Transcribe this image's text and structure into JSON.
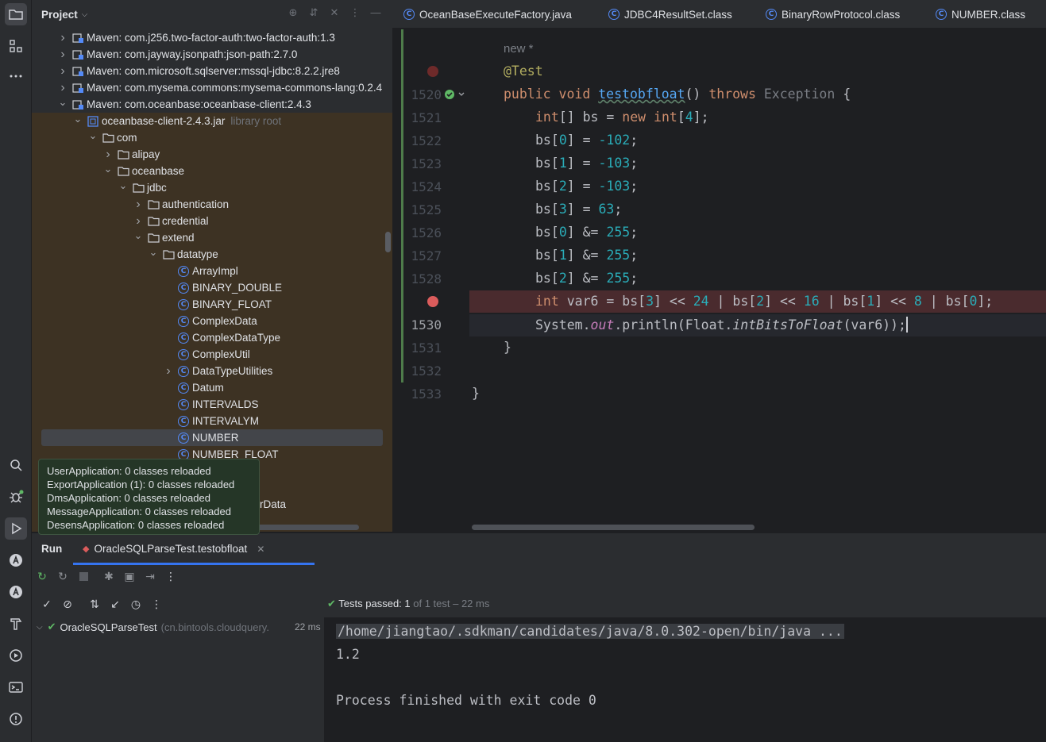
{
  "project": {
    "title": "Project",
    "tree": [
      {
        "label": "Maven: com.j256.two-factor-auth:two-factor-auth:1.3",
        "hint": "",
        "type": "lib",
        "indent": 0,
        "arrow": "right"
      },
      {
        "label": "Maven: com.jayway.jsonpath:json-path:2.7.0",
        "hint": "",
        "type": "lib",
        "indent": 0,
        "arrow": "right"
      },
      {
        "label": "Maven: com.microsoft.sqlserver:mssql-jdbc:8.2.2.jre8",
        "hint": "",
        "type": "lib",
        "indent": 0,
        "arrow": "right"
      },
      {
        "label": "Maven: com.mysema.commons:mysema-commons-lang:0.2.4",
        "hint": "",
        "type": "lib",
        "indent": 0,
        "arrow": "right"
      },
      {
        "label": "Maven: com.oceanbase:oceanbase-client:2.4.3",
        "hint": "",
        "type": "lib",
        "indent": 0,
        "arrow": "down"
      },
      {
        "label": "oceanbase-client-2.4.3.jar",
        "hint": "library root",
        "type": "jar",
        "indent": 1,
        "arrow": "down"
      },
      {
        "label": "com",
        "hint": "",
        "type": "folder",
        "indent": 2,
        "arrow": "down"
      },
      {
        "label": "alipay",
        "hint": "",
        "type": "folder",
        "indent": 3,
        "arrow": "right"
      },
      {
        "label": "oceanbase",
        "hint": "",
        "type": "folder",
        "indent": 3,
        "arrow": "down"
      },
      {
        "label": "jdbc",
        "hint": "",
        "type": "folder",
        "indent": 4,
        "arrow": "down"
      },
      {
        "label": "authentication",
        "hint": "",
        "type": "folder",
        "indent": 5,
        "arrow": "right"
      },
      {
        "label": "credential",
        "hint": "",
        "type": "folder",
        "indent": 5,
        "arrow": "right"
      },
      {
        "label": "extend",
        "hint": "",
        "type": "folder",
        "indent": 5,
        "arrow": "down"
      },
      {
        "label": "datatype",
        "hint": "",
        "type": "folder",
        "indent": 6,
        "arrow": "down"
      },
      {
        "label": "ArrayImpl",
        "hint": "",
        "type": "class",
        "indent": 7,
        "arrow": ""
      },
      {
        "label": "BINARY_DOUBLE",
        "hint": "",
        "type": "class",
        "indent": 7,
        "arrow": ""
      },
      {
        "label": "BINARY_FLOAT",
        "hint": "",
        "type": "class",
        "indent": 7,
        "arrow": ""
      },
      {
        "label": "ComplexData",
        "hint": "",
        "type": "class",
        "indent": 7,
        "arrow": ""
      },
      {
        "label": "ComplexDataType",
        "hint": "",
        "type": "class",
        "indent": 7,
        "arrow": ""
      },
      {
        "label": "ComplexUtil",
        "hint": "",
        "type": "class",
        "indent": 7,
        "arrow": ""
      },
      {
        "label": "DataTypeUtilities",
        "hint": "",
        "type": "class",
        "indent": 7,
        "arrow": "right"
      },
      {
        "label": "Datum",
        "hint": "",
        "type": "class",
        "indent": 7,
        "arrow": ""
      },
      {
        "label": "INTERVALDS",
        "hint": "",
        "type": "class",
        "indent": 7,
        "arrow": ""
      },
      {
        "label": "INTERVALYM",
        "hint": "",
        "type": "class",
        "indent": 7,
        "arrow": ""
      },
      {
        "label": "NUMBER",
        "hint": "",
        "type": "class",
        "indent": 7,
        "arrow": "",
        "selected": true
      },
      {
        "label": "NUMBER_FLOAT",
        "hint": "",
        "type": "class",
        "indent": 7,
        "arrow": ""
      }
    ],
    "partial_label": "rData"
  },
  "tooltip": {
    "lines": [
      "UserApplication: 0 classes reloaded",
      "ExportApplication (1): 0 classes reloaded",
      "DmsApplication: 0 classes reloaded",
      "MessageApplication: 0 classes reloaded",
      "DesensApplication: 0 classes reloaded"
    ]
  },
  "tabs": [
    {
      "label": "OceanBaseExecuteFactory.java"
    },
    {
      "label": "JDBC4ResultSet.class"
    },
    {
      "label": "BinaryRowProtocol.class"
    },
    {
      "label": "NUMBER.class"
    }
  ],
  "editor": {
    "inlay": "new *",
    "line_numbers": [
      "1520",
      "1521",
      "1522",
      "1523",
      "1524",
      "1525",
      "1526",
      "1527",
      "1528",
      "1530",
      "1531",
      "1532",
      "1533"
    ],
    "annotation": "@Test",
    "method_kw": "public void ",
    "method_name": "testobfloat",
    "method_tail_1": "() ",
    "throws_kw": "throws",
    "exception": " Exception ",
    "brace_open": "{",
    "l1521": {
      "a": "int",
      "b": "[] bs = ",
      "c": "new",
      "d": " ",
      "e": "int",
      "f": "[",
      "g": "4",
      "h": "];"
    },
    "assigns": [
      {
        "idx": "0",
        "op": " = ",
        "val": "-102",
        "end": ";"
      },
      {
        "idx": "1",
        "op": " = ",
        "val": "-103",
        "end": ";"
      },
      {
        "idx": "2",
        "op": " = ",
        "val": "-103",
        "end": ";"
      },
      {
        "idx": "3",
        "op": " = ",
        "val": "63",
        "end": ";"
      },
      {
        "idx": "0",
        "op": " &= ",
        "val": "255",
        "end": ";"
      },
      {
        "idx": "1",
        "op": " &= ",
        "val": "255",
        "end": ";"
      },
      {
        "idx": "2",
        "op": " &= ",
        "val": "255",
        "end": ";"
      }
    ],
    "l1529": {
      "kw": "int",
      "p1": " var6 = bs[",
      "n3": "3",
      "p2": "] << ",
      "n24": "24",
      "p3": " | bs[",
      "n2": "2",
      "p4": "] << ",
      "n16": "16",
      "p5": " | bs[",
      "n1": "1",
      "p6": "] << ",
      "n8": "8",
      "p7": " | bs[",
      "n0": "0",
      "p8": "];"
    },
    "l1530": {
      "p1": "System.",
      "out": "out",
      "p2": ".println(Float.",
      "fn": "intBitsToFloat",
      "p3": "(var6));"
    },
    "close_inner": "}",
    "close_outer": "}"
  },
  "run": {
    "title": "Run",
    "tab_label": "OracleSQLParseTest.testobfloat",
    "status_prefix": "Tests passed: ",
    "status_count": "1",
    "status_rest": " of 1 test – 22 ms",
    "test_name": "OracleSQLParseTest",
    "test_pkg": "(cn.bintools.cloudquery.",
    "test_time": "22 ms",
    "console": {
      "cmd": "/home/jiangtao/.sdkman/candidates/java/8.0.302-open/bin/java ...",
      "output": "1.2",
      "exit": "Process finished with exit code 0"
    }
  },
  "colors": {
    "accent": "#3574f0",
    "breakpoint": "#db5c5c",
    "success": "#5fb865",
    "library_bg": "#3d3223"
  }
}
